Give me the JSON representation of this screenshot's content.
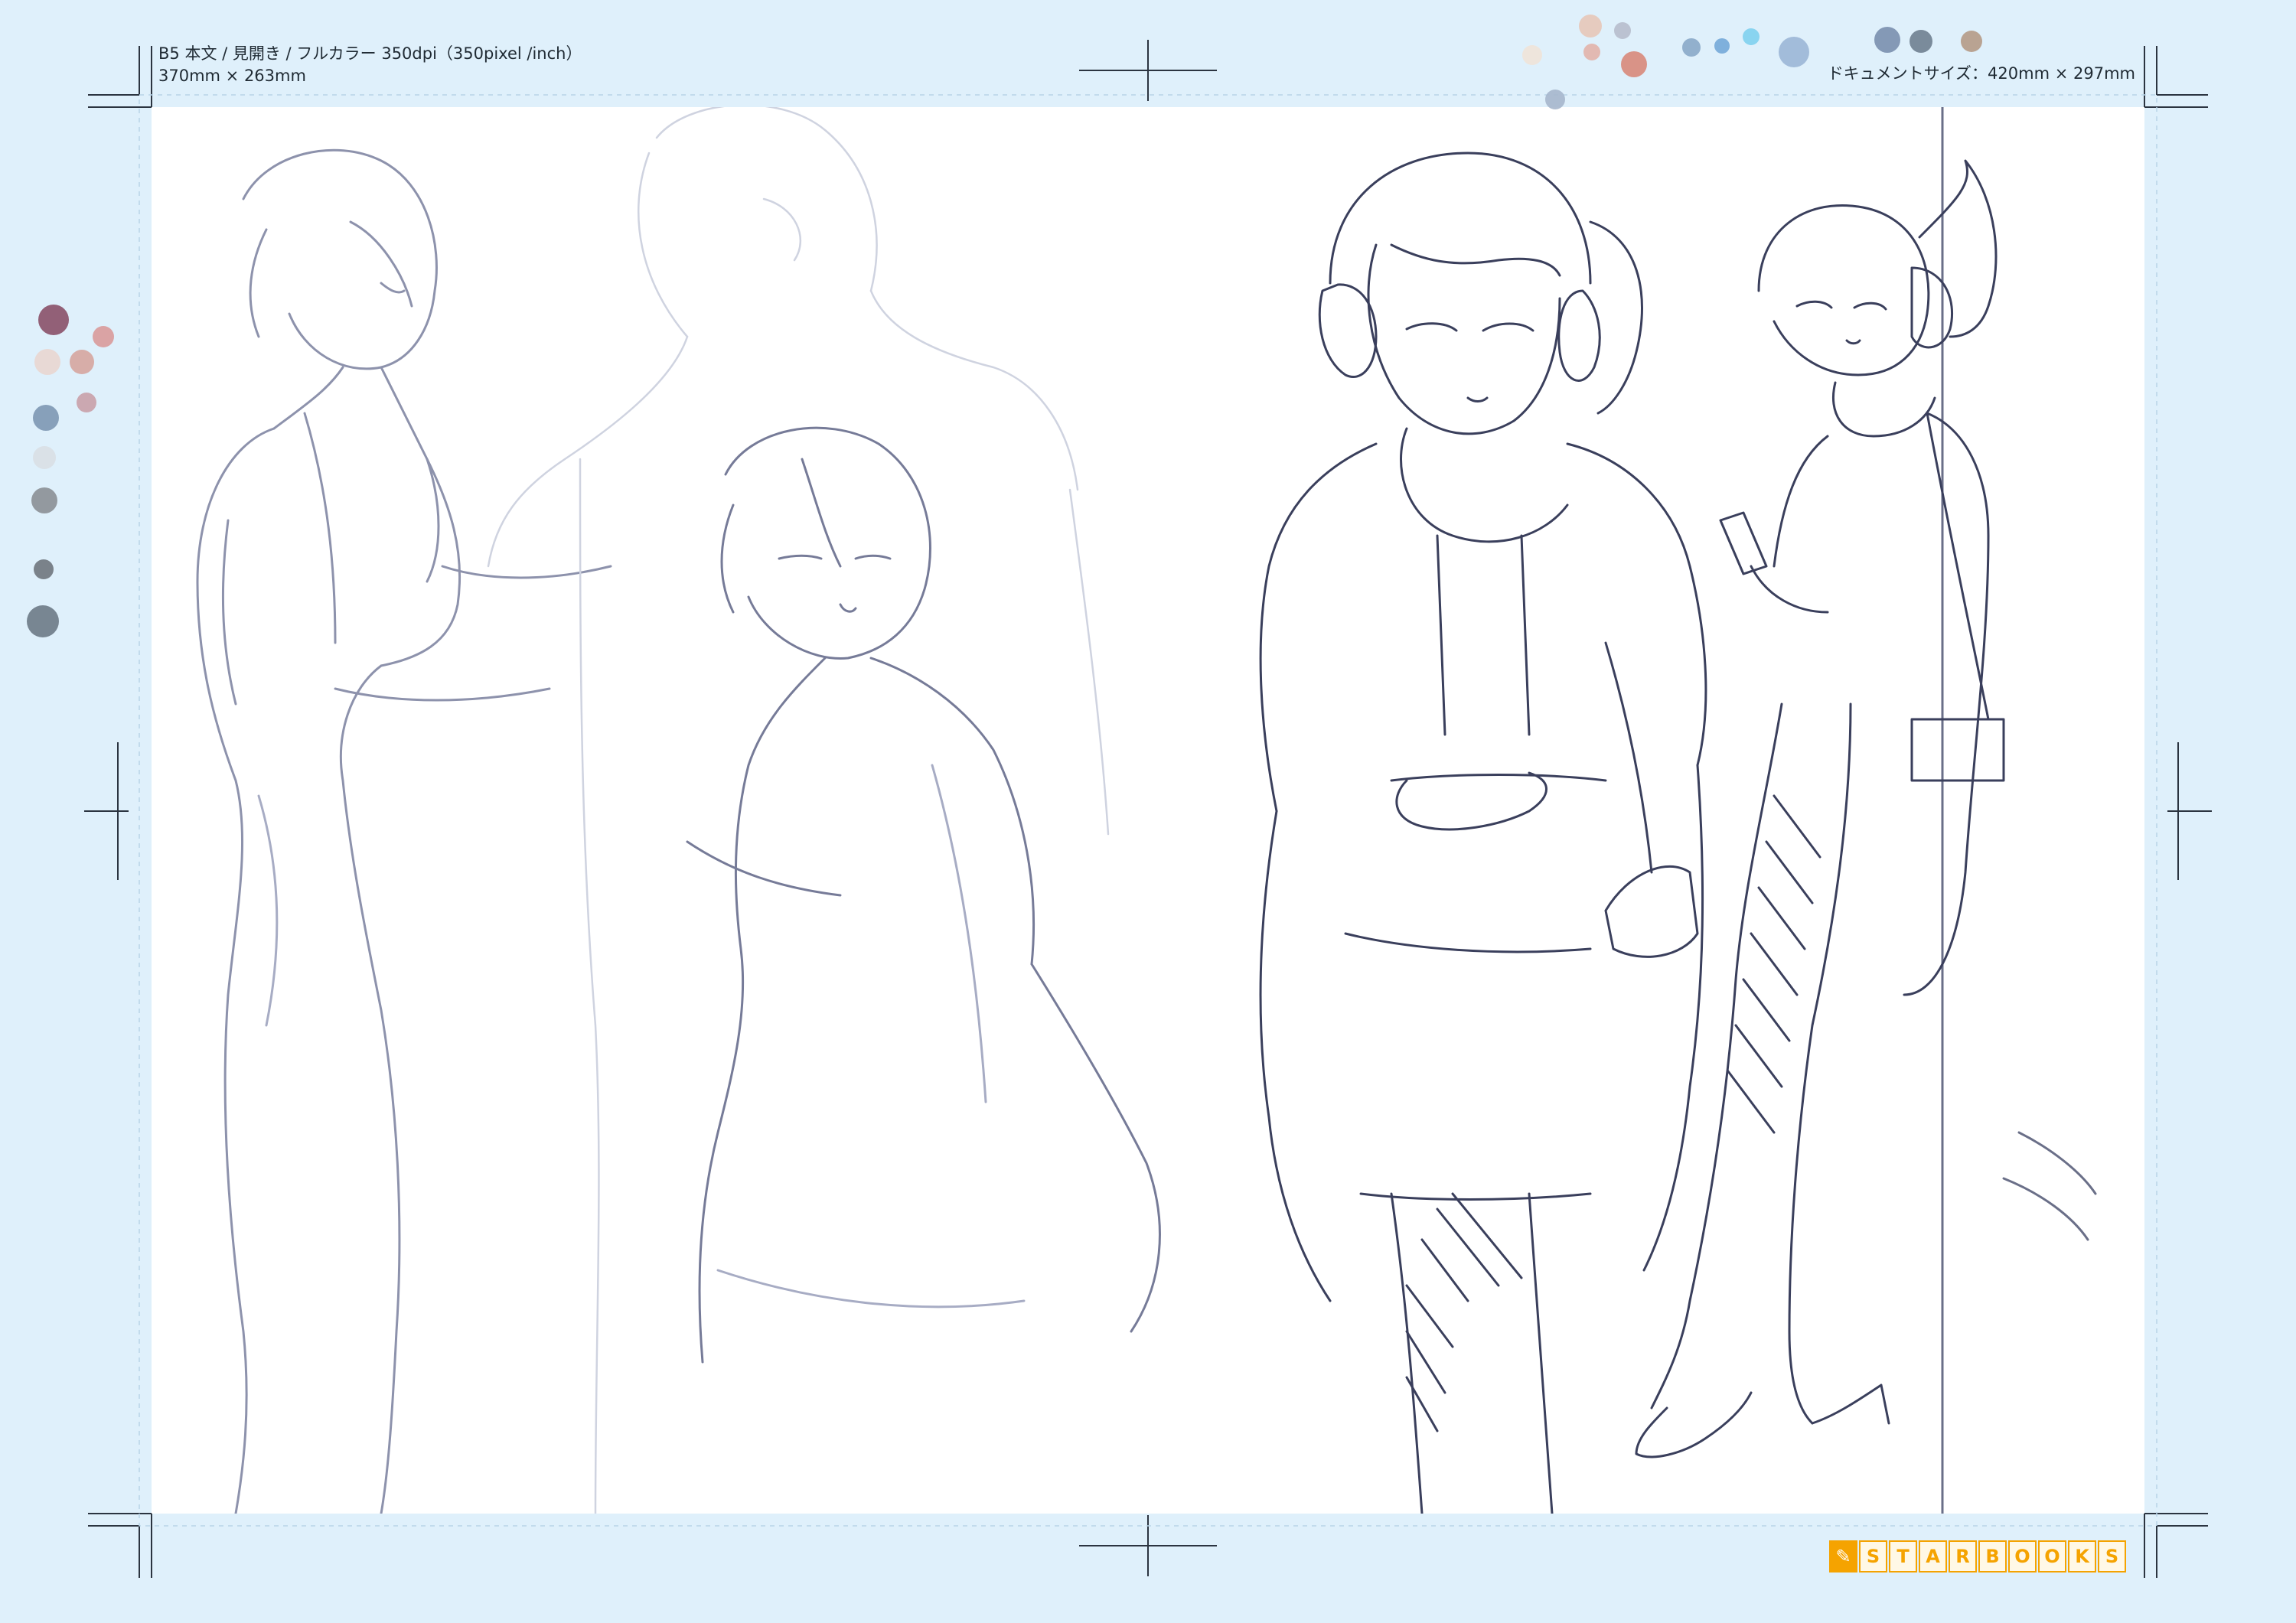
{
  "header": {
    "spec_line1": "B5 本文 / 見開き / フルカラー 350dpi（350pixel /inch）",
    "spec_line2": "370mm × 263mm",
    "document_size": "ドキュメントサイズ：420mm × 297mm"
  },
  "logo": {
    "letters": [
      "S",
      "T",
      "A",
      "R",
      "B",
      "O",
      "O",
      "K",
      "S"
    ]
  },
  "colors": {
    "page_background": "#dff0fb",
    "canvas": "#ffffff",
    "sketch_line": "#3a3f5c",
    "sketch_light": "#a7acc4",
    "crop_mark": "#2b3440",
    "logo_orange": "#f5a300"
  },
  "palette": {
    "swatch_colors": [
      "#8a5068",
      "#d99a9a",
      "#e9d6d0",
      "#d6a59f",
      "#c9a0a8",
      "#7d97b3",
      "#d9dfe4",
      "#8b8f95",
      "#6f767d",
      "#6d7a86",
      "#f0e3d8",
      "#e7c7b8",
      "#b7bdcc",
      "#e2b2aa",
      "#d8887a",
      "#a6b6cc",
      "#8aa9c8",
      "#74a9d8",
      "#7fd0ee",
      "#9bb6d6",
      "#7a8fae",
      "#6f7f90",
      "#b59a86"
    ]
  }
}
